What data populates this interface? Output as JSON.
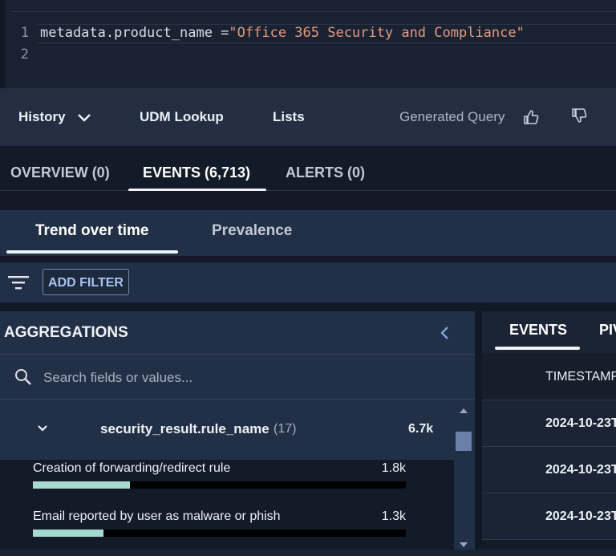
{
  "editor": {
    "lines": [
      {
        "number": "1",
        "ident": "metadata.product_name =",
        "string": "\"Office 365 Security and Compliance\""
      },
      {
        "number": "2",
        "ident": "",
        "string": ""
      }
    ]
  },
  "toolbar": {
    "history_label": "History",
    "udm_lookup_label": "UDM Lookup",
    "lists_label": "Lists",
    "generated_query_label": "Generated Query"
  },
  "main_tabs": [
    {
      "label": "OVERVIEW (0)"
    },
    {
      "label": "EVENTS (6,713)",
      "active": true
    },
    {
      "label": "ALERTS (0)"
    }
  ],
  "sub_tabs": [
    {
      "label": "Trend over time",
      "active": true
    },
    {
      "label": "Prevalence"
    }
  ],
  "filter": {
    "add_filter_label": "ADD FILTER"
  },
  "aggregations": {
    "title": "AGGREGATIONS",
    "search_placeholder": "Search fields or values...",
    "field": {
      "name": "security_result.rule_name",
      "count": "(17)",
      "total": "6.7k"
    },
    "values": [
      {
        "label": "Creation of forwarding/redirect rule",
        "count": "1.8k",
        "fraction": 0.26
      },
      {
        "label": "Email reported by user as malware or phish",
        "count": "1.3k",
        "fraction": 0.19
      }
    ]
  },
  "events_panel": {
    "tabs": [
      {
        "label": "EVENTS",
        "active": true
      },
      {
        "label": "PIV"
      }
    ],
    "column_header": "TIMESTAMP",
    "rows": [
      {
        "timestamp": "2024-10-23T"
      },
      {
        "timestamp": "2024-10-23T"
      },
      {
        "timestamp": "2024-10-23T"
      }
    ]
  },
  "colors": {
    "accent_bar": "#a5dbcf",
    "string_literal": "#e39a7e",
    "filter_text": "#a9c4ee"
  }
}
